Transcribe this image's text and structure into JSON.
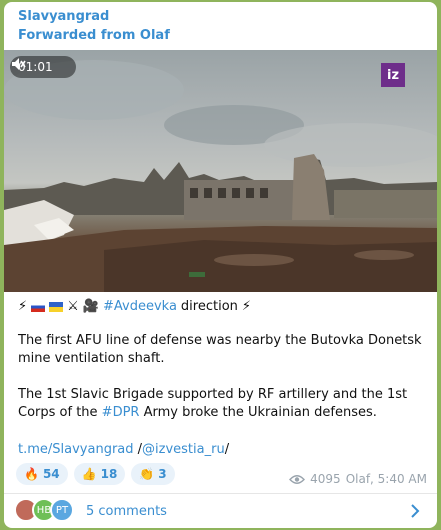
{
  "post": {
    "channel": "Slavyangrad",
    "forwarded": "Forwarded from Olaf",
    "video_time": "01:01",
    "video_logo": "iz",
    "line1_hashtag": "#Avdeevka",
    "line1_text": "direction",
    "para1": "The first AFU line of defense was nearby the Butovka Donetsk mine ventilation shaft.",
    "para2_before": "The 1st Slavic Brigade supported by RF artillery and the 1st Corps of the ",
    "para2_hashtag": "#DPR",
    "para2_after": " Army broke the Ukrainian defenses.",
    "link1": "t.me/Slavyangrad",
    "link_sep": " /",
    "link2": "@izvestia_ru",
    "link_end": "/",
    "views": "4095",
    "author_time": "Olaf, 5:40 AM"
  },
  "reactions": [
    {
      "emoji": "🔥",
      "count": "54"
    },
    {
      "emoji": "👍",
      "count": "18"
    },
    {
      "emoji": "👏",
      "count": "3"
    }
  ],
  "comments": {
    "label": "5 comments",
    "avatars": [
      "",
      "HB",
      "PT"
    ]
  },
  "colors": {
    "accent": "#3a8ed0",
    "background": "#8fb45c"
  }
}
